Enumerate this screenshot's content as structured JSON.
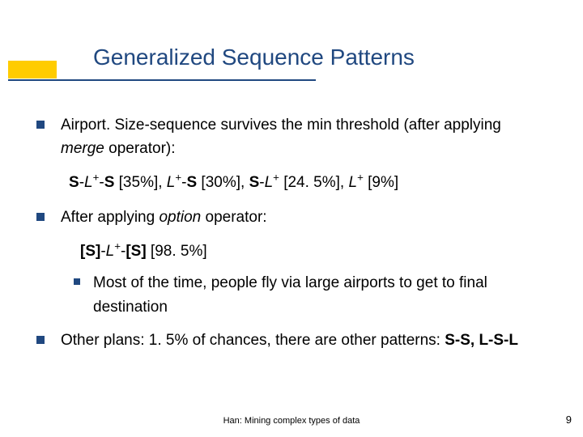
{
  "title": "Generalized Sequence Patterns",
  "bullets": {
    "b1_pre": "Airport. Size-sequence survives the min threshold (after applying ",
    "b1_em": "merge",
    "b1_post": " operator):",
    "seq1_parts": {
      "p1": "S",
      "dash1": "-",
      "p2": "L",
      "sup1": "+",
      "dash2": "-",
      "p3": "S",
      "v1": " [35%], ",
      "p4": "L",
      "sup2": "+",
      "dash3": "-",
      "p5": "S",
      "v2": " [30%], ",
      "p6": "S",
      "dash4": "-",
      "p7": "L",
      "sup3": "+",
      "v3": " [24. 5%], ",
      "p8": "L",
      "sup4": "+",
      "v4": " [9%]"
    },
    "b2_pre": "After applying ",
    "b2_em": "option",
    "b2_post": " operator:",
    "seq2_parts": {
      "p1": "[S]",
      "dash1": "-",
      "p2": "L",
      "sup1": "+",
      "dash2": "-",
      "p3": "[S]",
      "v1": " [98. 5%]"
    },
    "b2_1": "Most of the time, people fly via large airports to get to final destination",
    "b3_pre": "Other plans: 1. 5% of chances, there are other patterns: ",
    "b3_bold": "S-S, L-S-L"
  },
  "footer": {
    "center": "Han: Mining complex types of data",
    "page": "9"
  }
}
